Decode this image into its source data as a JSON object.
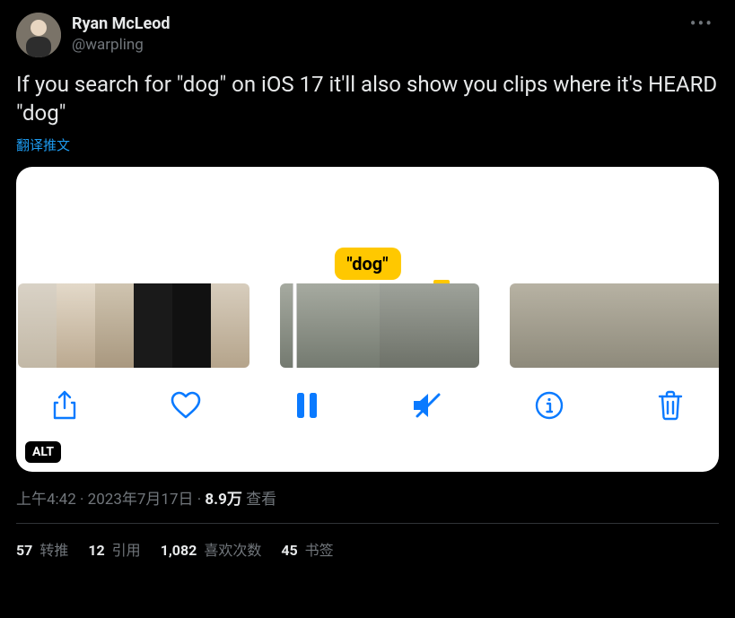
{
  "author": {
    "display_name": "Ryan McLeod",
    "handle": "@warpling"
  },
  "tweet_text": "If you search for \"dog\" on iOS 17 it'll also show you clips where it's HEARD \"dog\"",
  "translate_label": "翻译推文",
  "media": {
    "search_term": "\"dog\"",
    "alt_badge": "ALT",
    "toolbar_icons": {
      "share": "share-icon",
      "heart": "heart-icon",
      "pause": "pause-icon",
      "mute": "mute-icon",
      "info": "info-icon",
      "trash": "trash-icon"
    }
  },
  "meta": {
    "time": "上午4:42",
    "separator": " · ",
    "date": "2023年7月17日",
    "views_count": "8.9万",
    "views_label": " 查看"
  },
  "stats": {
    "retweets": {
      "count": "57",
      "label": " 转推"
    },
    "quotes": {
      "count": "12",
      "label": " 引用"
    },
    "likes": {
      "count": "1,082",
      "label": " 喜欢次数"
    },
    "bookmarks": {
      "count": "45",
      "label": " 书签"
    }
  }
}
